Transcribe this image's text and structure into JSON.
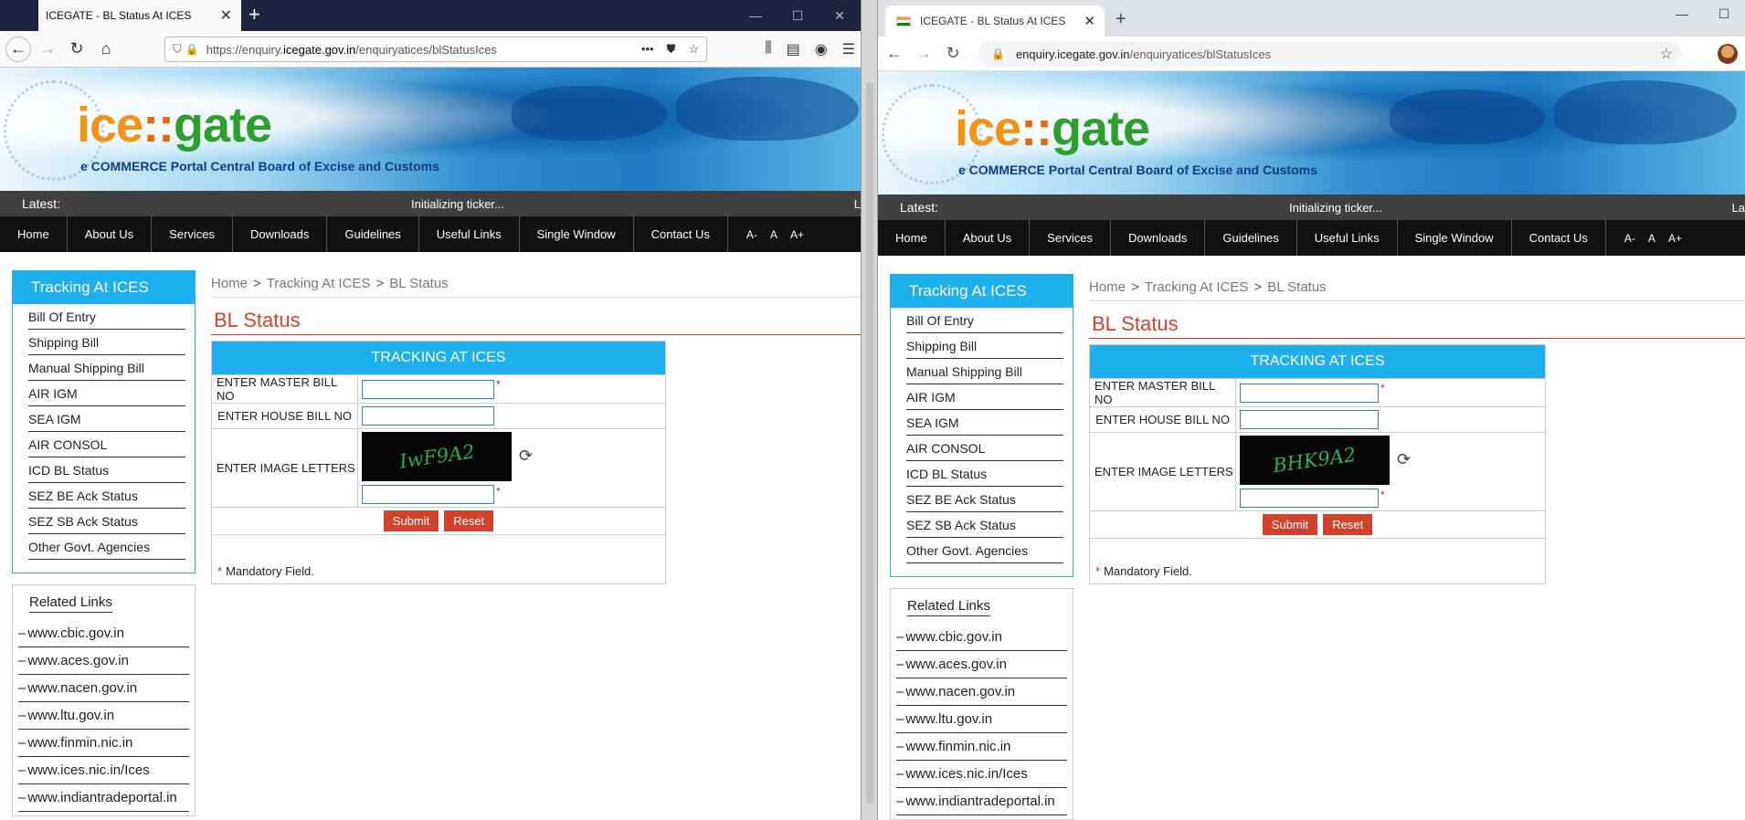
{
  "browser_a": {
    "tab_title": "ICEGATE - BL Status At ICES",
    "url_prefix": "https://enquiry.",
    "url_host": "icegate.gov.in",
    "url_path": "/enquiryatices/blStatusIces"
  },
  "browser_b": {
    "tab_title": "ICEGATE - BL Status At ICES",
    "url_host": "enquiry.icegate.gov.in",
    "url_path": "/enquiryatices/blStatusIces"
  },
  "site": {
    "logo_ice": "ice",
    "logo_sep": "::",
    "logo_gate": "gate",
    "tagline": "e COMMERCE Portal Central Board of Excise and Customs",
    "ticker_label": "Latest:",
    "ticker_msg": "Initializing ticker...",
    "ticker_tail_a": "L",
    "ticker_tail_b": "La",
    "menu": [
      "Home",
      "About Us",
      "Services",
      "Downloads",
      "Guidelines",
      "Useful Links",
      "Single Window",
      "Contact Us"
    ],
    "font_small": "A-",
    "font_normal": "A",
    "font_large": "A+"
  },
  "sidebar": {
    "heading": "Tracking At ICES",
    "items": [
      "Bill Of Entry",
      "Shipping Bill",
      "Manual Shipping Bill",
      "AIR IGM",
      "SEA IGM",
      "AIR CONSOL",
      "ICD BL Status",
      "SEZ BE Ack Status",
      "SEZ SB Ack Status",
      "Other Govt. Agencies"
    ],
    "related_heading": "Related Links",
    "related": [
      "www.cbic.gov.in",
      "www.aces.gov.in",
      "www.nacen.gov.in",
      "www.ltu.gov.in",
      "www.finmin.nic.in",
      "www.ices.nic.in/Ices",
      "www.indiantradeportal.in"
    ]
  },
  "breadcrumb": {
    "home": "Home",
    "section": "Tracking At ICES",
    "current": "BL Status",
    "sep": ">"
  },
  "page_title": "BL Status",
  "form": {
    "heading": "TRACKING AT ICES",
    "master_label": "ENTER MASTER BILL NO",
    "house_label": "ENTER HOUSE BILL NO",
    "image_label": "ENTER IMAGE LETTERS",
    "required_mark": "*",
    "submit": "Submit",
    "reset": "Reset",
    "mandatory_note": "Mandatory Field."
  },
  "captcha_a": "IwF9A2",
  "captcha_b": "BHK9A2"
}
